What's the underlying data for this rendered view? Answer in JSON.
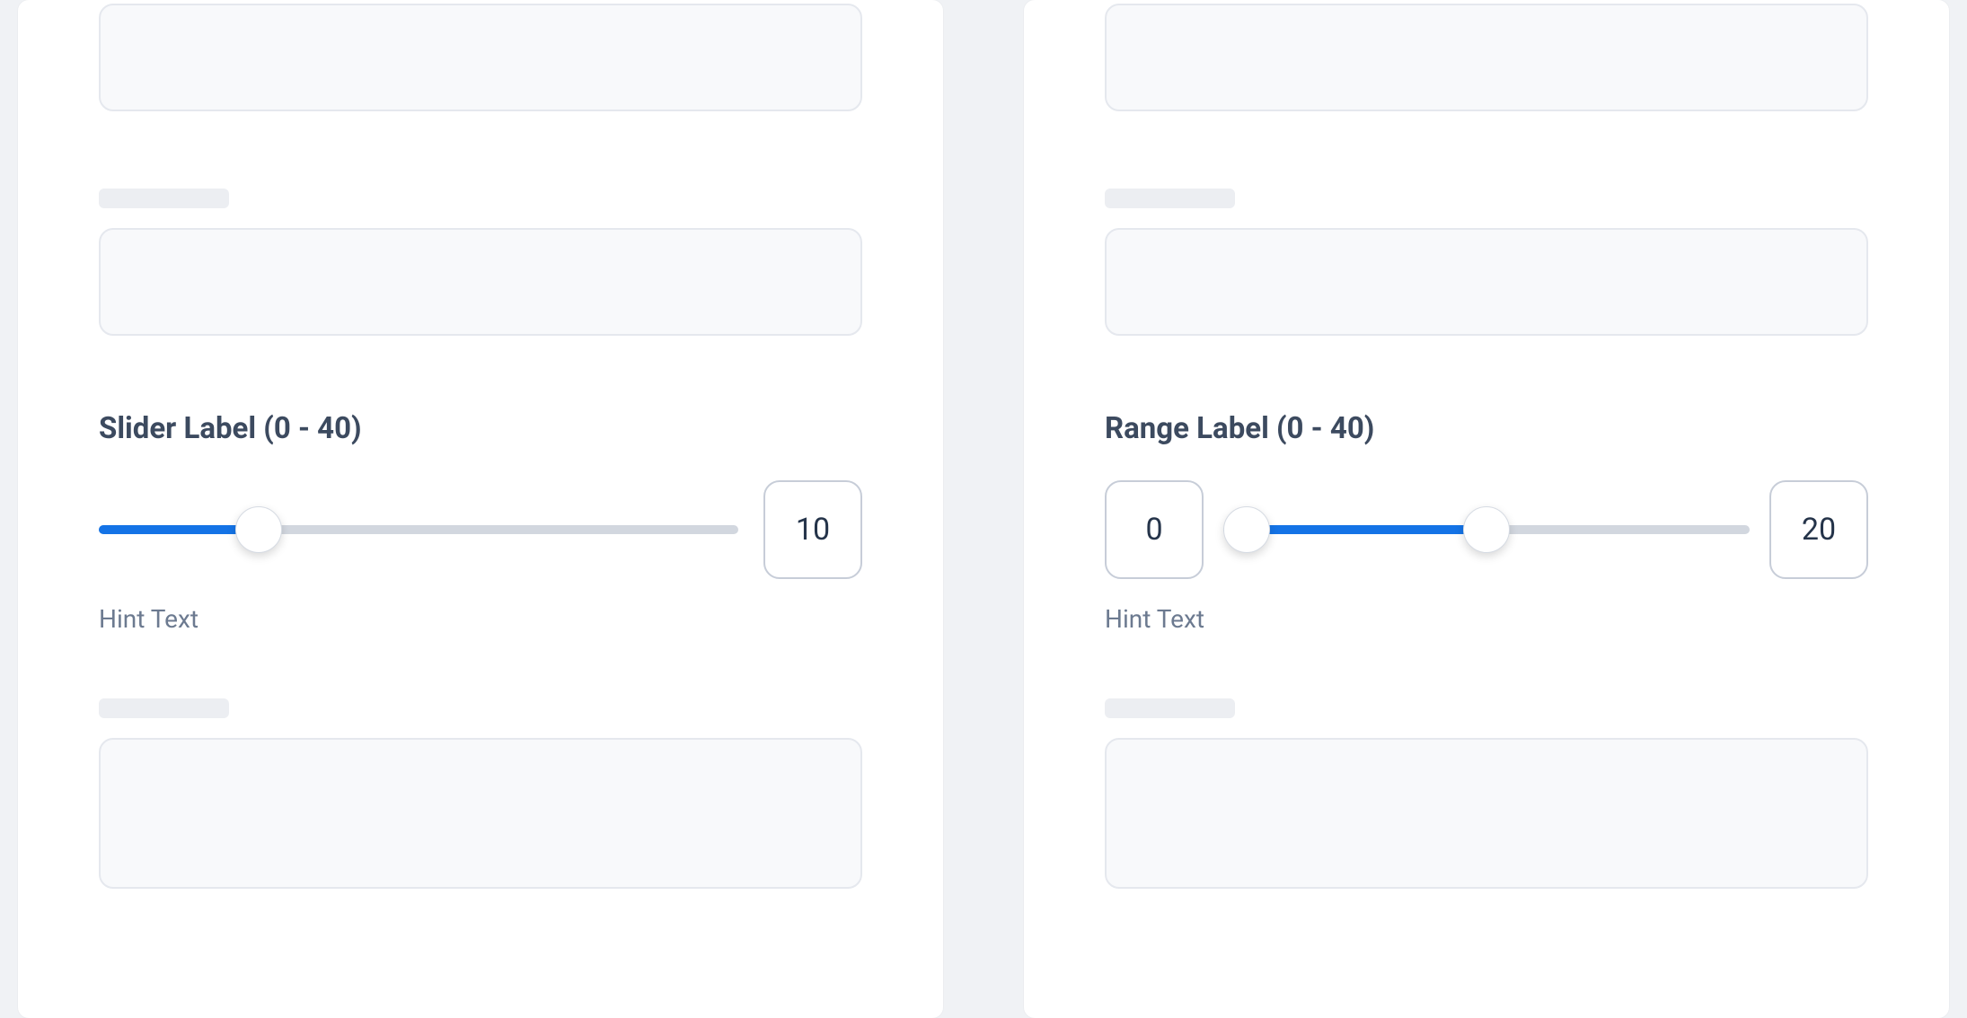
{
  "left": {
    "slider": {
      "label": "Slider Label (0 - 40)",
      "min": 0,
      "max": 40,
      "value": 10,
      "value_display": "10",
      "hint": "Hint Text"
    }
  },
  "right": {
    "range": {
      "label": "Range Label (0 - 40)",
      "min": 0,
      "max": 40,
      "low": 0,
      "high": 20,
      "low_display": "0",
      "high_display": "20",
      "hint": "Hint Text"
    }
  },
  "colors": {
    "accent": "#1473e6",
    "track": "#d2d7df",
    "text_primary": "#3c4a5f",
    "text_secondary": "#6c7a90"
  }
}
